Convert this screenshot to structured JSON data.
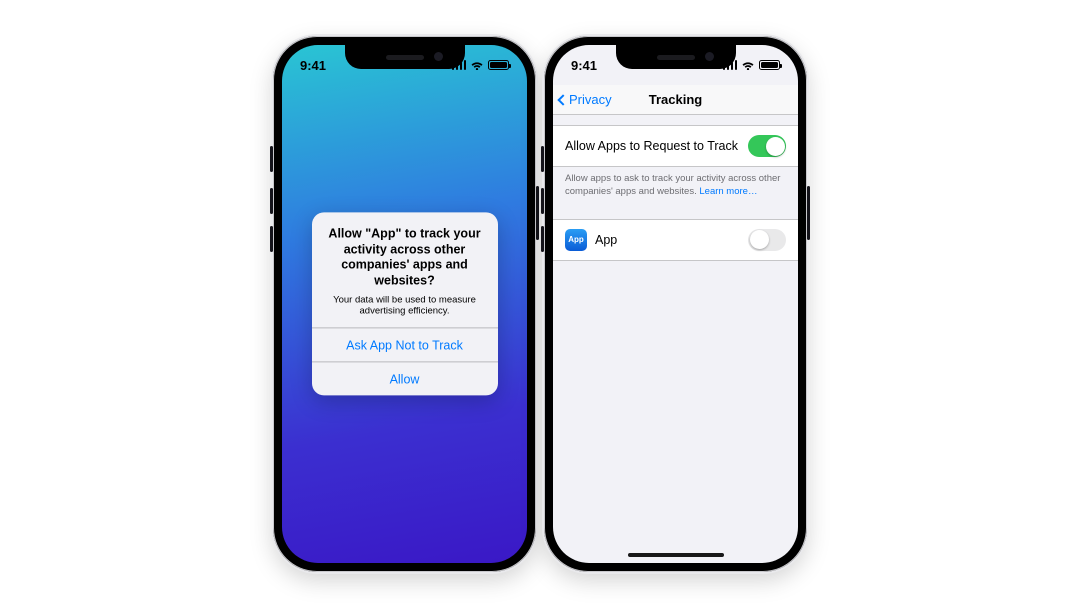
{
  "status": {
    "time": "9:41"
  },
  "left": {
    "alert": {
      "title": "Allow \"App\" to track your activity across other companies' apps and websites?",
      "message": "Your data will be used to measure advertising efficiency.",
      "deny_label": "Ask App Not to Track",
      "allow_label": "Allow"
    }
  },
  "right": {
    "nav": {
      "back_label": "Privacy",
      "title": "Tracking"
    },
    "master": {
      "label": "Allow Apps to Request to Track",
      "on": true
    },
    "footer": {
      "text": "Allow apps to ask to track your activity across other companies' apps and websites. ",
      "link": "Learn more…"
    },
    "apps": [
      {
        "icon_label": "App",
        "name": "App",
        "on": false
      }
    ]
  }
}
